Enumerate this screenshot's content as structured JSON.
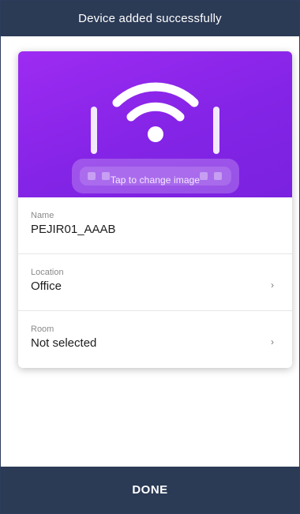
{
  "header": {
    "title": "Device added successfully"
  },
  "device_card": {
    "image_hint": "Tap to change image",
    "image_icon": "wifi-router-icon",
    "fields": {
      "name": {
        "label": "Name",
        "value": "PEJIR01_AAAB"
      },
      "location": {
        "label": "Location",
        "value": "Office",
        "chevron": "›"
      },
      "room": {
        "label": "Room",
        "value": "Not selected",
        "chevron": "›"
      }
    }
  },
  "footer": {
    "done_label": "DONE"
  },
  "colors": {
    "header_bg": "#2b3a55",
    "hero_gradient_start": "#9e2bf2",
    "hero_gradient_end": "#7a22df",
    "footer_bg": "#2b3a55"
  }
}
